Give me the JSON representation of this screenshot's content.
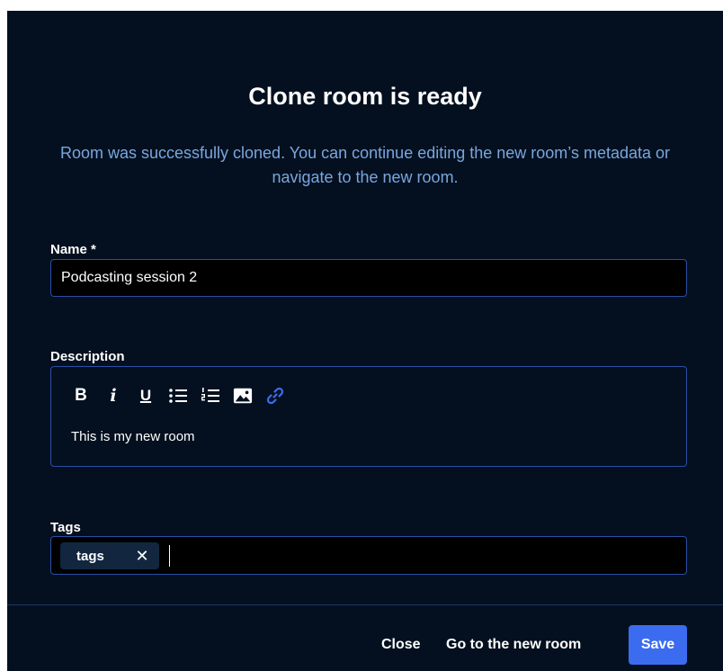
{
  "dialog": {
    "title": "Clone room is ready",
    "subtitle": "Room was successfully cloned. You can continue editing the new room’s metadata or navigate to the new room."
  },
  "form": {
    "name_label": "Name *",
    "name_value": "Podcasting session 2",
    "description_label": "Description",
    "description_text": "This is my new room",
    "toolbar": {
      "bold": "B",
      "italic": "i",
      "underline": "U",
      "icons": [
        "bold-icon",
        "italic-icon",
        "underline-icon",
        "bullet-list-icon",
        "numbered-list-icon",
        "image-icon",
        "link-icon"
      ]
    },
    "tags_label": "Tags",
    "tags": [
      "tags"
    ],
    "tag_remove": "✕"
  },
  "footer": {
    "close_label": "Close",
    "go_to_label": "Go to the new room",
    "save_label": "Save"
  },
  "colors": {
    "background": "#04101f",
    "subtitle": "#7aa6de",
    "border": "#2a4fa5",
    "accent": "#3b6cf0",
    "link_icon": "#3b6cf0"
  }
}
